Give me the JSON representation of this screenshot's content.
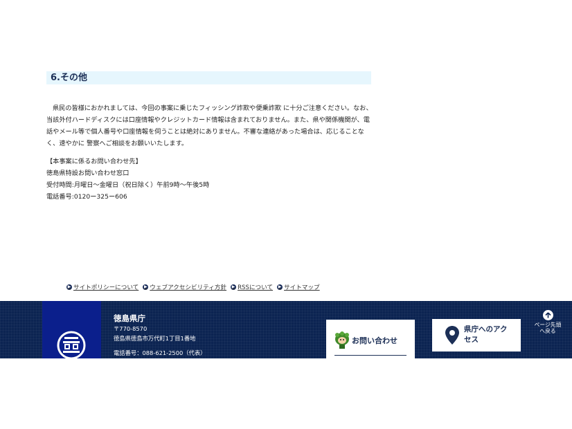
{
  "section": {
    "heading": "6.その他"
  },
  "notice": {
    "paragraph": "県民の皆様におかれましては、今回の事案に乗じたフィッシング詐欺や便乗詐欺 に十分ご注意ください。なお、当該外付ハードディスクには口座情報やクレジットカード情報は含まれておりません。また、県や関係機関が、電話やメール等で個人番号や口座情報を伺うことは絶対にありません。不審な連絡があった場合は、応じることなく、速やかに 警察へご相談をお願いいたします。"
  },
  "contact": {
    "header": "【本事案に係るお問い合わせ先】",
    "office": "徳島県特設お問い合わせ窓口",
    "hours": "受付時間:月曜日～金曜日（祝日除く）午前9時～午後5時",
    "phone": "電話番号:0120ー325ー606"
  },
  "footer_links": [
    {
      "label": "サイトポリシーについて"
    },
    {
      "label": "ウェブアクセシビリティ方針"
    },
    {
      "label": "RSSについて"
    },
    {
      "label": "サイトマップ"
    }
  ],
  "footer": {
    "org_name": "徳島県庁",
    "postal": "〒770-8570",
    "address": "徳島県徳島市万代町1丁目1番地",
    "phone": "電話番号：088-621-2500（代表）",
    "inquiry_label": "お問い合わせ",
    "access_label": "県庁へのアクセス",
    "pagetop_label": "ページ先頭へ戻る",
    "colors": {
      "footer_bg": "#0c2452",
      "emblem_bg": "#0b1f8c",
      "heading_bg": "#e6f6fd",
      "accent": "#1c2f56"
    }
  }
}
